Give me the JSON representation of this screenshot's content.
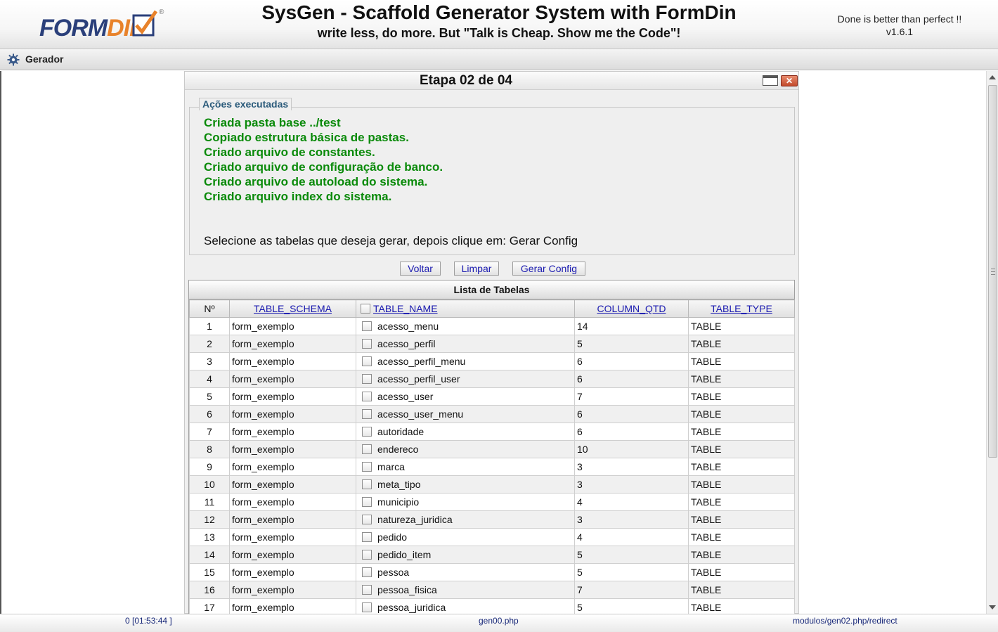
{
  "header": {
    "logo_text": "FORMDIN",
    "title": "SysGen - Scaffold Generator System with FormDin",
    "subtitle": "write less, do more. But \"Talk is Cheap. Show me the Code\"!",
    "motto": "Done is better than perfect !!",
    "version": "v1.6.1"
  },
  "menu": {
    "items": [
      {
        "label": "Gerador",
        "icon": "gear-icon"
      }
    ]
  },
  "panel": {
    "title": "Etapa 02 de 04",
    "fieldset": {
      "legend": "Ações executadas",
      "messages": [
        "Criada pasta base ../test",
        "Copiado estrutura básica de pastas.",
        "Criado arquivo de constantes.",
        "Criado arquivo de configuração de banco.",
        "Criado arquivo de autoload do sistema.",
        "Criado arquivo index do sistema."
      ],
      "instruction": "Selecione as tabelas que deseja gerar, depois clique em: Gerar Config"
    },
    "buttons": {
      "voltar": "Voltar",
      "limpar": "Limpar",
      "gerar_config": "Gerar Config"
    },
    "grid": {
      "caption": "Lista de Tabelas",
      "columns": {
        "num": "Nº",
        "schema": "TABLE_SCHEMA",
        "name": "TABLE_NAME",
        "qtd": "COLUMN_QTD",
        "type": "TABLE_TYPE"
      },
      "rows": [
        {
          "num": "1",
          "schema": "form_exemplo",
          "name": "acesso_menu",
          "qtd": "14",
          "type": "TABLE"
        },
        {
          "num": "2",
          "schema": "form_exemplo",
          "name": "acesso_perfil",
          "qtd": "5",
          "type": "TABLE"
        },
        {
          "num": "3",
          "schema": "form_exemplo",
          "name": "acesso_perfil_menu",
          "qtd": "6",
          "type": "TABLE"
        },
        {
          "num": "4",
          "schema": "form_exemplo",
          "name": "acesso_perfil_user",
          "qtd": "6",
          "type": "TABLE"
        },
        {
          "num": "5",
          "schema": "form_exemplo",
          "name": "acesso_user",
          "qtd": "7",
          "type": "TABLE"
        },
        {
          "num": "6",
          "schema": "form_exemplo",
          "name": "acesso_user_menu",
          "qtd": "6",
          "type": "TABLE"
        },
        {
          "num": "7",
          "schema": "form_exemplo",
          "name": "autoridade",
          "qtd": "6",
          "type": "TABLE"
        },
        {
          "num": "8",
          "schema": "form_exemplo",
          "name": "endereco",
          "qtd": "10",
          "type": "TABLE"
        },
        {
          "num": "9",
          "schema": "form_exemplo",
          "name": "marca",
          "qtd": "3",
          "type": "TABLE"
        },
        {
          "num": "10",
          "schema": "form_exemplo",
          "name": "meta_tipo",
          "qtd": "3",
          "type": "TABLE"
        },
        {
          "num": "11",
          "schema": "form_exemplo",
          "name": "municipio",
          "qtd": "4",
          "type": "TABLE"
        },
        {
          "num": "12",
          "schema": "form_exemplo",
          "name": "natureza_juridica",
          "qtd": "3",
          "type": "TABLE"
        },
        {
          "num": "13",
          "schema": "form_exemplo",
          "name": "pedido",
          "qtd": "4",
          "type": "TABLE"
        },
        {
          "num": "14",
          "schema": "form_exemplo",
          "name": "pedido_item",
          "qtd": "5",
          "type": "TABLE"
        },
        {
          "num": "15",
          "schema": "form_exemplo",
          "name": "pessoa",
          "qtd": "5",
          "type": "TABLE"
        },
        {
          "num": "16",
          "schema": "form_exemplo",
          "name": "pessoa_fisica",
          "qtd": "7",
          "type": "TABLE"
        },
        {
          "num": "17",
          "schema": "form_exemplo",
          "name": "pessoa_juridica",
          "qtd": "5",
          "type": "TABLE"
        }
      ]
    }
  },
  "statusbar": {
    "left": "0 [01:53:44 ]",
    "middle": "gen00.php",
    "right": "modulos/gen02.php/redirect"
  }
}
